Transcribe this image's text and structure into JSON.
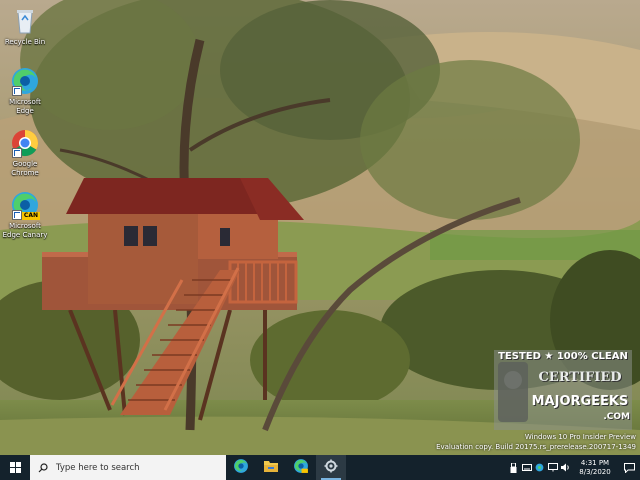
{
  "desktop": {
    "icons": [
      {
        "label": "Recycle Bin",
        "icon": "recycle-bin-icon"
      },
      {
        "label": "Microsoft Edge",
        "icon": "edge-icon"
      },
      {
        "label": "Google Chrome",
        "icon": "chrome-icon"
      },
      {
        "label": "Microsoft Edge Canary",
        "icon": "edge-canary-icon",
        "badge": "CAN"
      }
    ],
    "watermark": {
      "line1": "Windows 10 Pro Insider Preview",
      "line2": "Evaluation copy. Build 20175.rs_prerelease.200717-1349"
    },
    "badge_logo": {
      "text_top": "TESTED ★ 100% CLEAN",
      "text_mid": "CERTIFIED",
      "text_brand": "MAJORGEEKS",
      "text_dotcom": ".COM"
    }
  },
  "taskbar": {
    "search_placeholder": "Type here to search",
    "apps": [
      {
        "name": "edge-taskbar",
        "icon": "edge-icon"
      },
      {
        "name": "file-explorer-taskbar",
        "icon": "folder-icon"
      },
      {
        "name": "edge-canary-taskbar",
        "icon": "edge-canary-icon"
      },
      {
        "name": "settings-taskbar",
        "icon": "gear-icon",
        "running": true
      }
    ],
    "clock": {
      "time": "4:31 PM",
      "date": "8/3/2020"
    },
    "tray_icons": [
      "usb-icon",
      "keyboard-icon",
      "edge-tray-icon",
      "network-icon",
      "volume-icon"
    ],
    "colors": {
      "taskbar_bg": "#14222c",
      "accent": "#79b4e0"
    }
  }
}
